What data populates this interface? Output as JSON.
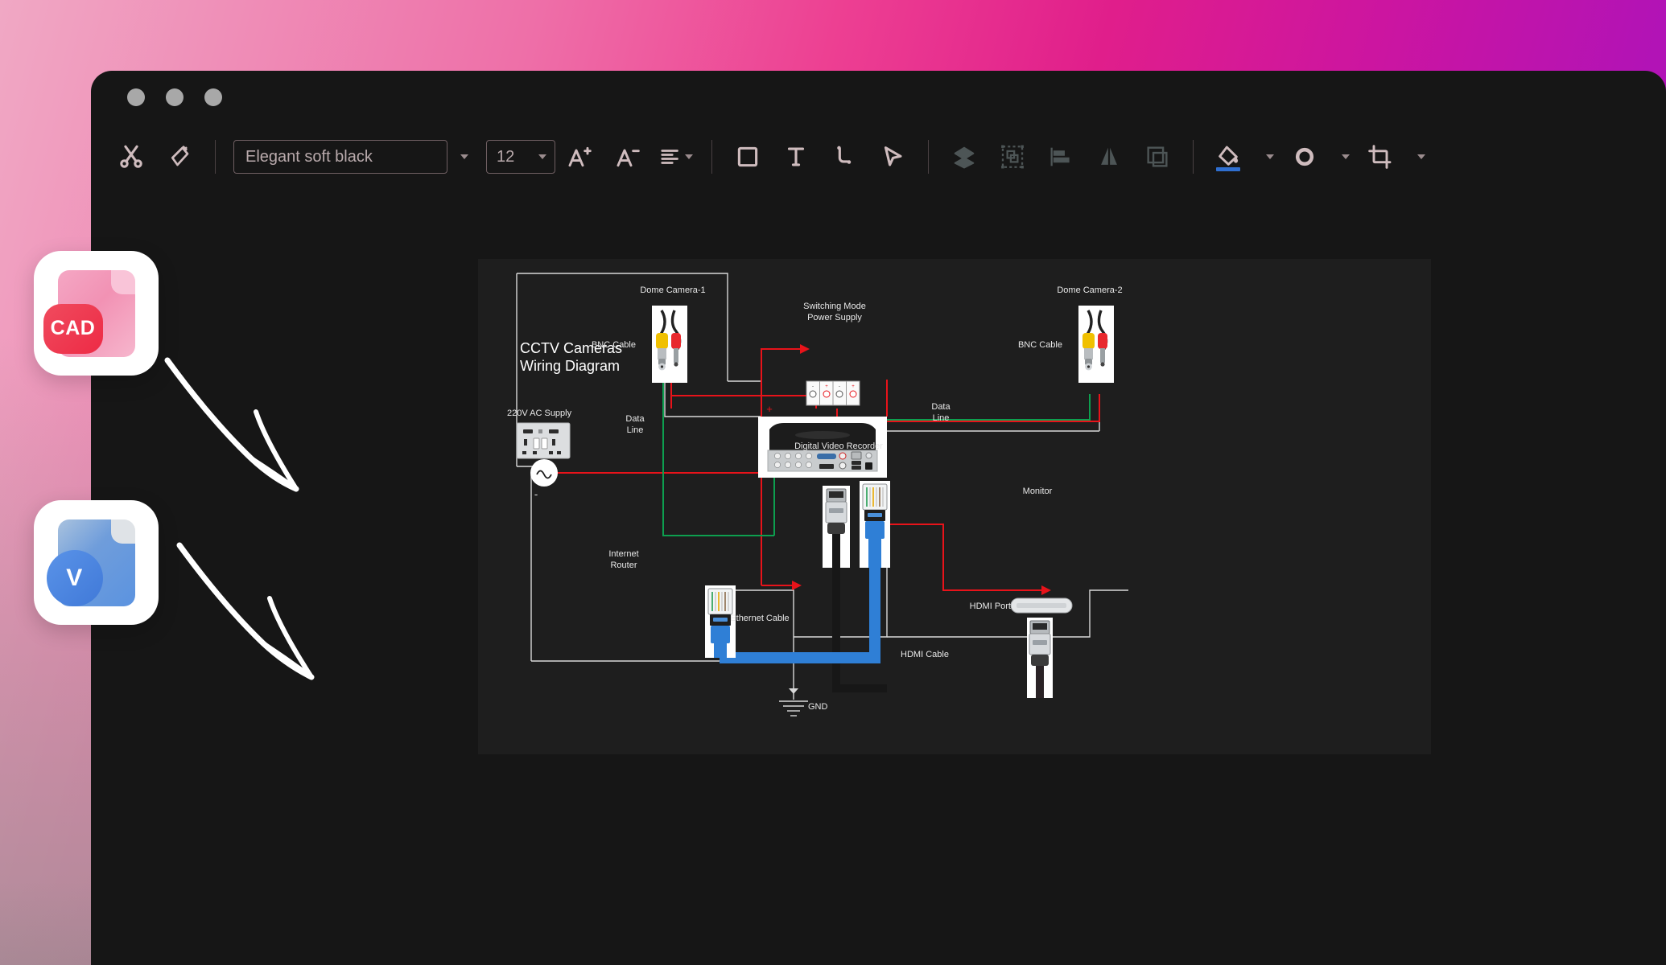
{
  "window": {
    "traffic_lights": [
      "close",
      "minimize",
      "maximize"
    ]
  },
  "toolbar": {
    "cut_label": "cut-tool",
    "format_painter_label": "format-painter",
    "font_name": "Elegant soft black",
    "font_name_placeholder": "Elegant soft black",
    "font_size": "12",
    "increase_font_label": "A+",
    "decrease_font_label": "A-",
    "align_label": "align",
    "shape_label": "shape",
    "text_label": "text-box",
    "connector_label": "connector",
    "pointer_label": "pointer",
    "layers_label": "layers",
    "group_label": "group",
    "align_objects_label": "align-objects",
    "flip_label": "flip",
    "arrange_label": "arrange",
    "fill_label": "fill-color",
    "line_color_label": "line-color",
    "crop_label": "crop",
    "fill_accent_color": "#2f6fd0",
    "icon_color": "#cfbcbe",
    "grey_icon_color": "#5a6162"
  },
  "files": [
    {
      "name": "CAD",
      "type": "cad-file",
      "primary_color": "#ef4056",
      "secondary_color": "#f08ab0"
    },
    {
      "name": "V",
      "type": "visio-file",
      "primary_color": "#4a86e8",
      "secondary_color": "#a8c0de"
    }
  ],
  "diagram": {
    "title": "CCTV Cameras\nWiring Diagram",
    "labels": {
      "dome_camera_1": "Dome Camera-1",
      "dome_camera_2": "Dome Camera-2",
      "bnc_cable_1": "BNC Cable",
      "bnc_cable_2": "BNC Cable",
      "switching_mode_power_supply": "Switching Mode\nPower Supply",
      "ac_supply": "220V AC Supply",
      "data_line_1": "Data\nLine",
      "data_line_2": "Data\nLine",
      "digital_video_recorder": "Digital Video Recorder",
      "monitor": "Monitor",
      "internet_router": "Internet\nRouter",
      "ethernet_cable": "Ethernet Cable",
      "hdmi_port": "HDMI Port",
      "hdmi_cable": "HDMI Cable",
      "gnd": "GND",
      "plus_sign": "+",
      "minus_sign": "-",
      "terminal_polarity": [
        "-",
        "+",
        "-",
        "+"
      ]
    },
    "colors": {
      "power_line": "#e8131a",
      "data_line": "#0d9f4f",
      "signal_line": "#d8d8d8",
      "ethernet_cable": "#2f7fd6",
      "hdmi_cable": "#1a1a1a",
      "page_background": "#1e1e1e"
    }
  }
}
